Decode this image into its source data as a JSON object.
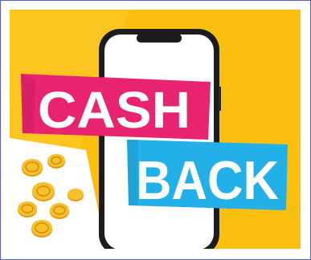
{
  "banner": {
    "word_top": "CASH",
    "word_bottom": "BACK"
  },
  "colors": {
    "frame_border": "#5b5bd6",
    "background": "#fbbf10",
    "ribbon_pink": "#e8236f",
    "ribbon_blue": "#23b0e8",
    "phone_body": "#1c1c1c",
    "screen": "#ffffff",
    "coin": "#f2b21a"
  },
  "icons": [
    "phone-icon",
    "coin-icon"
  ]
}
